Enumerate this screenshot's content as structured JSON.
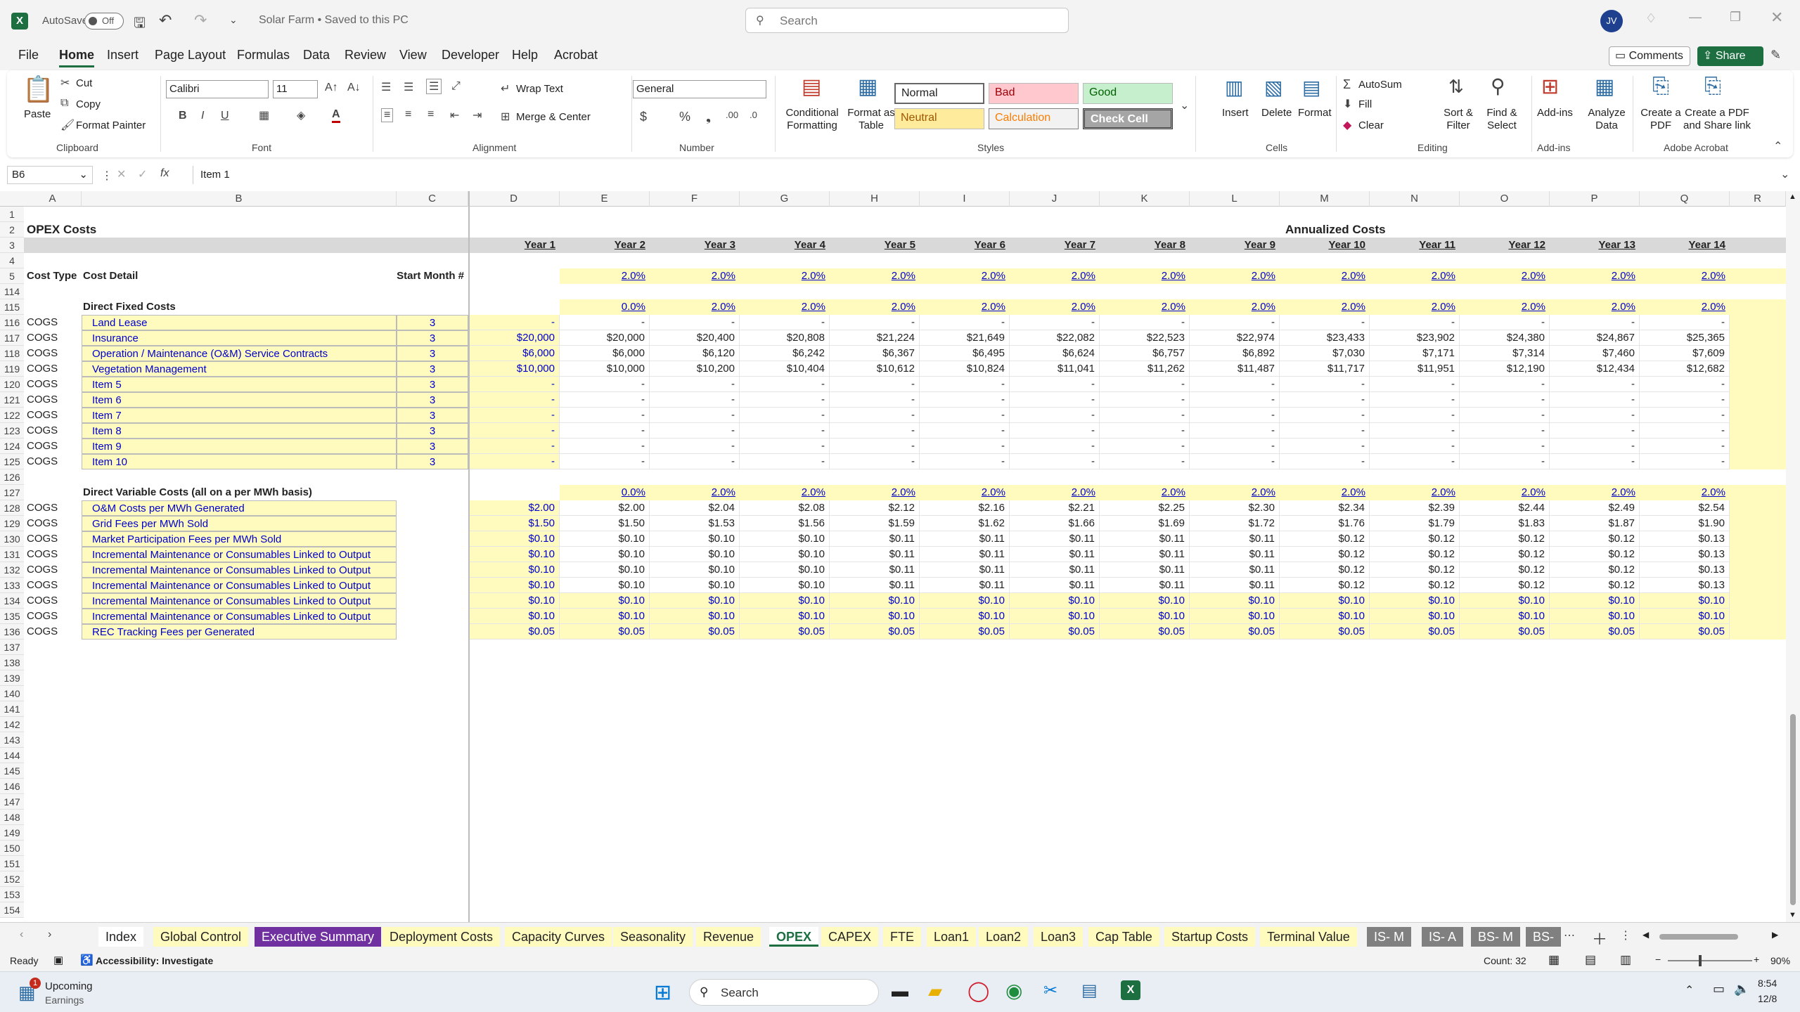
{
  "titlebar": {
    "autosave": "AutoSave",
    "autosave_state": "Off",
    "doc_title": "Solar Farm • Saved to this PC",
    "search_placeholder": "Search",
    "avatar": "JV"
  },
  "menu": [
    "File",
    "Home",
    "Insert",
    "Page Layout",
    "Formulas",
    "Data",
    "Review",
    "View",
    "Developer",
    "Help",
    "Acrobat"
  ],
  "menu_actions": {
    "comments": "Comments",
    "share": "Share"
  },
  "ribbon": {
    "clipboard": {
      "paste": "Paste",
      "cut": "Cut",
      "copy": "Copy",
      "format_painter": "Format Painter",
      "label": "Clipboard"
    },
    "font": {
      "name": "Calibri",
      "size": "11",
      "label": "Font"
    },
    "alignment": {
      "wrap": "Wrap Text",
      "merge": "Merge & Center",
      "label": "Alignment"
    },
    "number": {
      "format": "General",
      "label": "Number"
    },
    "styles": {
      "cond": "Conditional Formatting",
      "fmt_table": "Format as Table",
      "normal": "Normal",
      "bad": "Bad",
      "good": "Good",
      "neutral": "Neutral",
      "calculation": "Calculation",
      "check": "Check Cell",
      "label": "Styles"
    },
    "cells": {
      "insert": "Insert",
      "delete": "Delete",
      "format": "Format",
      "label": "Cells"
    },
    "editing": {
      "autosum": "AutoSum",
      "fill": "Fill",
      "clear": "Clear",
      "sort": "Sort & Filter",
      "find": "Find & Select",
      "label": "Editing"
    },
    "addins": {
      "addins": "Add-ins",
      "analyze": "Analyze Data",
      "label": "Add-ins"
    },
    "acrobat": {
      "create_pdf": "Create a PDF",
      "create_share": "Create a PDF and Share link",
      "label": "Adobe Acrobat"
    }
  },
  "formula": {
    "namebox": "B6",
    "fx": "fx",
    "value": "Item 1"
  },
  "columns": [
    "A",
    "B",
    "C",
    "D",
    "E",
    "F",
    "G",
    "H",
    "I",
    "J",
    "K",
    "L",
    "M",
    "N",
    "O",
    "P",
    "Q",
    "R"
  ],
  "rows": [
    "1",
    "2",
    "3",
    "4",
    "5",
    "114",
    "115",
    "116",
    "117",
    "118",
    "119",
    "120",
    "121",
    "122",
    "123",
    "124",
    "125",
    "126",
    "127",
    "128",
    "129",
    "130",
    "131",
    "132",
    "133",
    "134",
    "135",
    "136",
    "137",
    "138",
    "139",
    "140",
    "141",
    "142",
    "143",
    "144",
    "145",
    "146",
    "147",
    "148",
    "149",
    "150",
    "151",
    "152",
    "153",
    "154"
  ],
  "sheet": {
    "title": "OPEX Costs",
    "annualized": "Annualized Costs",
    "years": [
      "Year 1",
      "Year 2",
      "Year 3",
      "Year 4",
      "Year 5",
      "Year 6",
      "Year 7",
      "Year 8",
      "Year 9",
      "Year 10",
      "Year 11",
      "Year 12",
      "Year 13",
      "Year 14"
    ],
    "hdr_cost_type": "Cost Type",
    "hdr_cost_detail": "Cost Detail",
    "hdr_start": "Start Month #",
    "growth5": [
      "",
      "2.0%",
      "2.0%",
      "2.0%",
      "2.0%",
      "2.0%",
      "2.0%",
      "2.0%",
      "2.0%",
      "2.0%",
      "2.0%",
      "2.0%",
      "2.0%",
      "2.0%"
    ],
    "fixed_title": "Direct Fixed Costs",
    "growth115": [
      "",
      "0.0%",
      "2.0%",
      "2.0%",
      "2.0%",
      "2.0%",
      "2.0%",
      "2.0%",
      "2.0%",
      "2.0%",
      "2.0%",
      "2.0%",
      "2.0%",
      "2.0%"
    ],
    "fixed_rows": [
      {
        "type": "COGS",
        "detail": "Land Lease",
        "start": "3",
        "vals": [
          "-",
          "-",
          "-",
          "-",
          "-",
          "-",
          "-",
          "-",
          "-",
          "-",
          "-",
          "-",
          "-",
          "-"
        ]
      },
      {
        "type": "COGS",
        "detail": "Insurance",
        "start": "3",
        "vals": [
          "$20,000",
          "$20,000",
          "$20,400",
          "$20,808",
          "$21,224",
          "$21,649",
          "$22,082",
          "$22,523",
          "$22,974",
          "$23,433",
          "$23,902",
          "$24,380",
          "$24,867",
          "$25,365"
        ]
      },
      {
        "type": "COGS",
        "detail": "Operation / Maintenance (O&M) Service Contracts",
        "start": "3",
        "vals": [
          "$6,000",
          "$6,000",
          "$6,120",
          "$6,242",
          "$6,367",
          "$6,495",
          "$6,624",
          "$6,757",
          "$6,892",
          "$7,030",
          "$7,171",
          "$7,314",
          "$7,460",
          "$7,609"
        ]
      },
      {
        "type": "COGS",
        "detail": "Vegetation Management",
        "start": "3",
        "vals": [
          "$10,000",
          "$10,000",
          "$10,200",
          "$10,404",
          "$10,612",
          "$10,824",
          "$11,041",
          "$11,262",
          "$11,487",
          "$11,717",
          "$11,951",
          "$12,190",
          "$12,434",
          "$12,682"
        ]
      },
      {
        "type": "COGS",
        "detail": "Item 5",
        "start": "3",
        "vals": [
          "-",
          "-",
          "-",
          "-",
          "-",
          "-",
          "-",
          "-",
          "-",
          "-",
          "-",
          "-",
          "-",
          "-"
        ]
      },
      {
        "type": "COGS",
        "detail": "Item 6",
        "start": "3",
        "vals": [
          "-",
          "-",
          "-",
          "-",
          "-",
          "-",
          "-",
          "-",
          "-",
          "-",
          "-",
          "-",
          "-",
          "-"
        ]
      },
      {
        "type": "COGS",
        "detail": "Item 7",
        "start": "3",
        "vals": [
          "-",
          "-",
          "-",
          "-",
          "-",
          "-",
          "-",
          "-",
          "-",
          "-",
          "-",
          "-",
          "-",
          "-"
        ]
      },
      {
        "type": "COGS",
        "detail": "Item 8",
        "start": "3",
        "vals": [
          "-",
          "-",
          "-",
          "-",
          "-",
          "-",
          "-",
          "-",
          "-",
          "-",
          "-",
          "-",
          "-",
          "-"
        ]
      },
      {
        "type": "COGS",
        "detail": "Item 9",
        "start": "3",
        "vals": [
          "-",
          "-",
          "-",
          "-",
          "-",
          "-",
          "-",
          "-",
          "-",
          "-",
          "-",
          "-",
          "-",
          "-"
        ]
      },
      {
        "type": "COGS",
        "detail": "Item 10",
        "start": "3",
        "vals": [
          "-",
          "-",
          "-",
          "-",
          "-",
          "-",
          "-",
          "-",
          "-",
          "-",
          "-",
          "-",
          "-",
          "-"
        ]
      }
    ],
    "var_title": "Direct Variable Costs (all on a per MWh basis)",
    "growth127": [
      "",
      "0.0%",
      "2.0%",
      "2.0%",
      "2.0%",
      "2.0%",
      "2.0%",
      "2.0%",
      "2.0%",
      "2.0%",
      "2.0%",
      "2.0%",
      "2.0%",
      "2.0%"
    ],
    "var_rows": [
      {
        "type": "COGS",
        "detail": "O&M Costs per MWh Generated",
        "vals": [
          "$2.00",
          "$2.00",
          "$2.04",
          "$2.08",
          "$2.12",
          "$2.16",
          "$2.21",
          "$2.25",
          "$2.30",
          "$2.34",
          "$2.39",
          "$2.44",
          "$2.49",
          "$2.54"
        ],
        "blue": false
      },
      {
        "type": "COGS",
        "detail": "Grid Fees per MWh Sold",
        "vals": [
          "$1.50",
          "$1.50",
          "$1.53",
          "$1.56",
          "$1.59",
          "$1.62",
          "$1.66",
          "$1.69",
          "$1.72",
          "$1.76",
          "$1.79",
          "$1.83",
          "$1.87",
          "$1.90"
        ],
        "blue": false
      },
      {
        "type": "COGS",
        "detail": "Market Participation Fees per MWh Sold",
        "vals": [
          "$0.10",
          "$0.10",
          "$0.10",
          "$0.10",
          "$0.11",
          "$0.11",
          "$0.11",
          "$0.11",
          "$0.11",
          "$0.12",
          "$0.12",
          "$0.12",
          "$0.12",
          "$0.13"
        ],
        "blue": false
      },
      {
        "type": "COGS",
        "detail": "Incremental Maintenance or Consumables Linked to Output",
        "vals": [
          "$0.10",
          "$0.10",
          "$0.10",
          "$0.10",
          "$0.11",
          "$0.11",
          "$0.11",
          "$0.11",
          "$0.11",
          "$0.12",
          "$0.12",
          "$0.12",
          "$0.12",
          "$0.13"
        ],
        "blue": false
      },
      {
        "type": "COGS",
        "detail": "Incremental Maintenance or Consumables Linked to Output",
        "vals": [
          "$0.10",
          "$0.10",
          "$0.10",
          "$0.10",
          "$0.11",
          "$0.11",
          "$0.11",
          "$0.11",
          "$0.11",
          "$0.12",
          "$0.12",
          "$0.12",
          "$0.12",
          "$0.13"
        ],
        "blue": false
      },
      {
        "type": "COGS",
        "detail": "Incremental Maintenance or Consumables Linked to Output",
        "vals": [
          "$0.10",
          "$0.10",
          "$0.10",
          "$0.10",
          "$0.11",
          "$0.11",
          "$0.11",
          "$0.11",
          "$0.11",
          "$0.12",
          "$0.12",
          "$0.12",
          "$0.12",
          "$0.13"
        ],
        "blue": false
      },
      {
        "type": "COGS",
        "detail": "Incremental Maintenance or Consumables Linked to Output",
        "vals": [
          "$0.10",
          "$0.10",
          "$0.10",
          "$0.10",
          "$0.10",
          "$0.10",
          "$0.10",
          "$0.10",
          "$0.10",
          "$0.10",
          "$0.10",
          "$0.10",
          "$0.10",
          "$0.10"
        ],
        "blue": true
      },
      {
        "type": "COGS",
        "detail": "Incremental Maintenance or Consumables Linked to Output",
        "vals": [
          "$0.10",
          "$0.10",
          "$0.10",
          "$0.10",
          "$0.10",
          "$0.10",
          "$0.10",
          "$0.10",
          "$0.10",
          "$0.10",
          "$0.10",
          "$0.10",
          "$0.10",
          "$0.10"
        ],
        "blue": true
      },
      {
        "type": "COGS",
        "detail": "REC Tracking Fees per Generated",
        "vals": [
          "$0.05",
          "$0.05",
          "$0.05",
          "$0.05",
          "$0.05",
          "$0.05",
          "$0.05",
          "$0.05",
          "$0.05",
          "$0.05",
          "$0.05",
          "$0.05",
          "$0.05",
          "$0.05"
        ],
        "blue": true
      }
    ]
  },
  "tabs": [
    {
      "label": "Index",
      "bg": "#ffffff"
    },
    {
      "label": "Global Control",
      "bg": "#fffbbf"
    },
    {
      "label": "Executive Summary",
      "bg": "#7030a0",
      "fg": "#ffffff"
    },
    {
      "label": "Deployment Costs",
      "bg": "#fffbbf"
    },
    {
      "label": "Capacity Curves",
      "bg": "#fffbbf"
    },
    {
      "label": "Seasonality",
      "bg": "#fffbbf"
    },
    {
      "label": "Revenue",
      "bg": "#fffbbf"
    },
    {
      "label": "OPEX",
      "bg": "#ffffff",
      "active": true
    },
    {
      "label": "CAPEX",
      "bg": "#fffbbf"
    },
    {
      "label": "FTE",
      "bg": "#fffbbf"
    },
    {
      "label": "Loan1",
      "bg": "#fffbbf"
    },
    {
      "label": "Loan2",
      "bg": "#fffbbf"
    },
    {
      "label": "Loan3",
      "bg": "#fffbbf"
    },
    {
      "label": "Cap Table",
      "bg": "#fffbbf"
    },
    {
      "label": "Startup Costs",
      "bg": "#fffbbf"
    },
    {
      "label": "Terminal Value",
      "bg": "#fffbbf"
    },
    {
      "label": "IS- M",
      "bg": "#808080",
      "fg": "#ffffff"
    },
    {
      "label": "IS- A",
      "bg": "#808080",
      "fg": "#ffffff"
    },
    {
      "label": "BS- M",
      "bg": "#808080",
      "fg": "#ffffff"
    },
    {
      "label": "BS-",
      "bg": "#808080",
      "fg": "#ffffff"
    }
  ],
  "status": {
    "ready": "Ready",
    "accessibility": "Accessibility: Investigate",
    "count": "Count: 32",
    "zoom": "90%"
  },
  "taskbar": {
    "weather_title": "Upcoming",
    "weather_sub": "Earnings",
    "search": "Search",
    "time": "8:54",
    "date": "12/8",
    "badge": "1"
  }
}
